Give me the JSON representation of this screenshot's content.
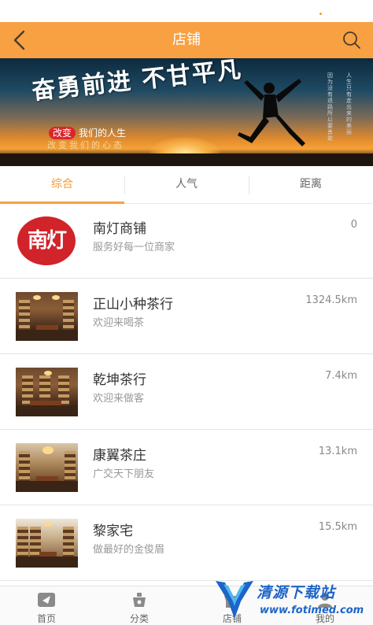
{
  "header": {
    "title": "店铺",
    "back_icon": "chevron-left-icon",
    "search_icon": "search-icon"
  },
  "banner": {
    "slogan_main": "奋勇前进 不甘平凡",
    "tag_pill": "改变",
    "tag_text": "我们的人生",
    "sub_line": "改变我们的心态",
    "vertical_left": "因为没有退路所以要勇敢",
    "vertical_right": "人生只有走出来的美丽"
  },
  "tabs": [
    {
      "label": "综合",
      "active": true
    },
    {
      "label": "人气",
      "active": false
    },
    {
      "label": "距离",
      "active": false
    }
  ],
  "shops": [
    {
      "name": "南灯商铺",
      "desc": "服务好每一位商家",
      "distance": "0",
      "logo_text": "南灯"
    },
    {
      "name": "正山小种茶行",
      "desc": "欢迎来喝茶",
      "distance": "1324.5km"
    },
    {
      "name": "乾坤茶行",
      "desc": "欢迎来做客",
      "distance": "7.4km"
    },
    {
      "name": "康翼茶庄",
      "desc": "广交天下朋友",
      "distance": "13.1km"
    },
    {
      "name": "黎家宅",
      "desc": "做最好的金俊眉",
      "distance": "15.5km"
    }
  ],
  "tabbar": [
    {
      "label": "首页",
      "icon": "home-icon"
    },
    {
      "label": "分类",
      "icon": "category-icon"
    },
    {
      "label": "店铺",
      "icon": "shop-icon"
    },
    {
      "label": "我的",
      "icon": "user-icon"
    }
  ],
  "watermark": {
    "text": "清源下载站",
    "url": "www.fotimed.com"
  },
  "colors": {
    "accent": "#f7a142",
    "active_tab": "#f39a33",
    "logo_red": "#d0232a"
  }
}
